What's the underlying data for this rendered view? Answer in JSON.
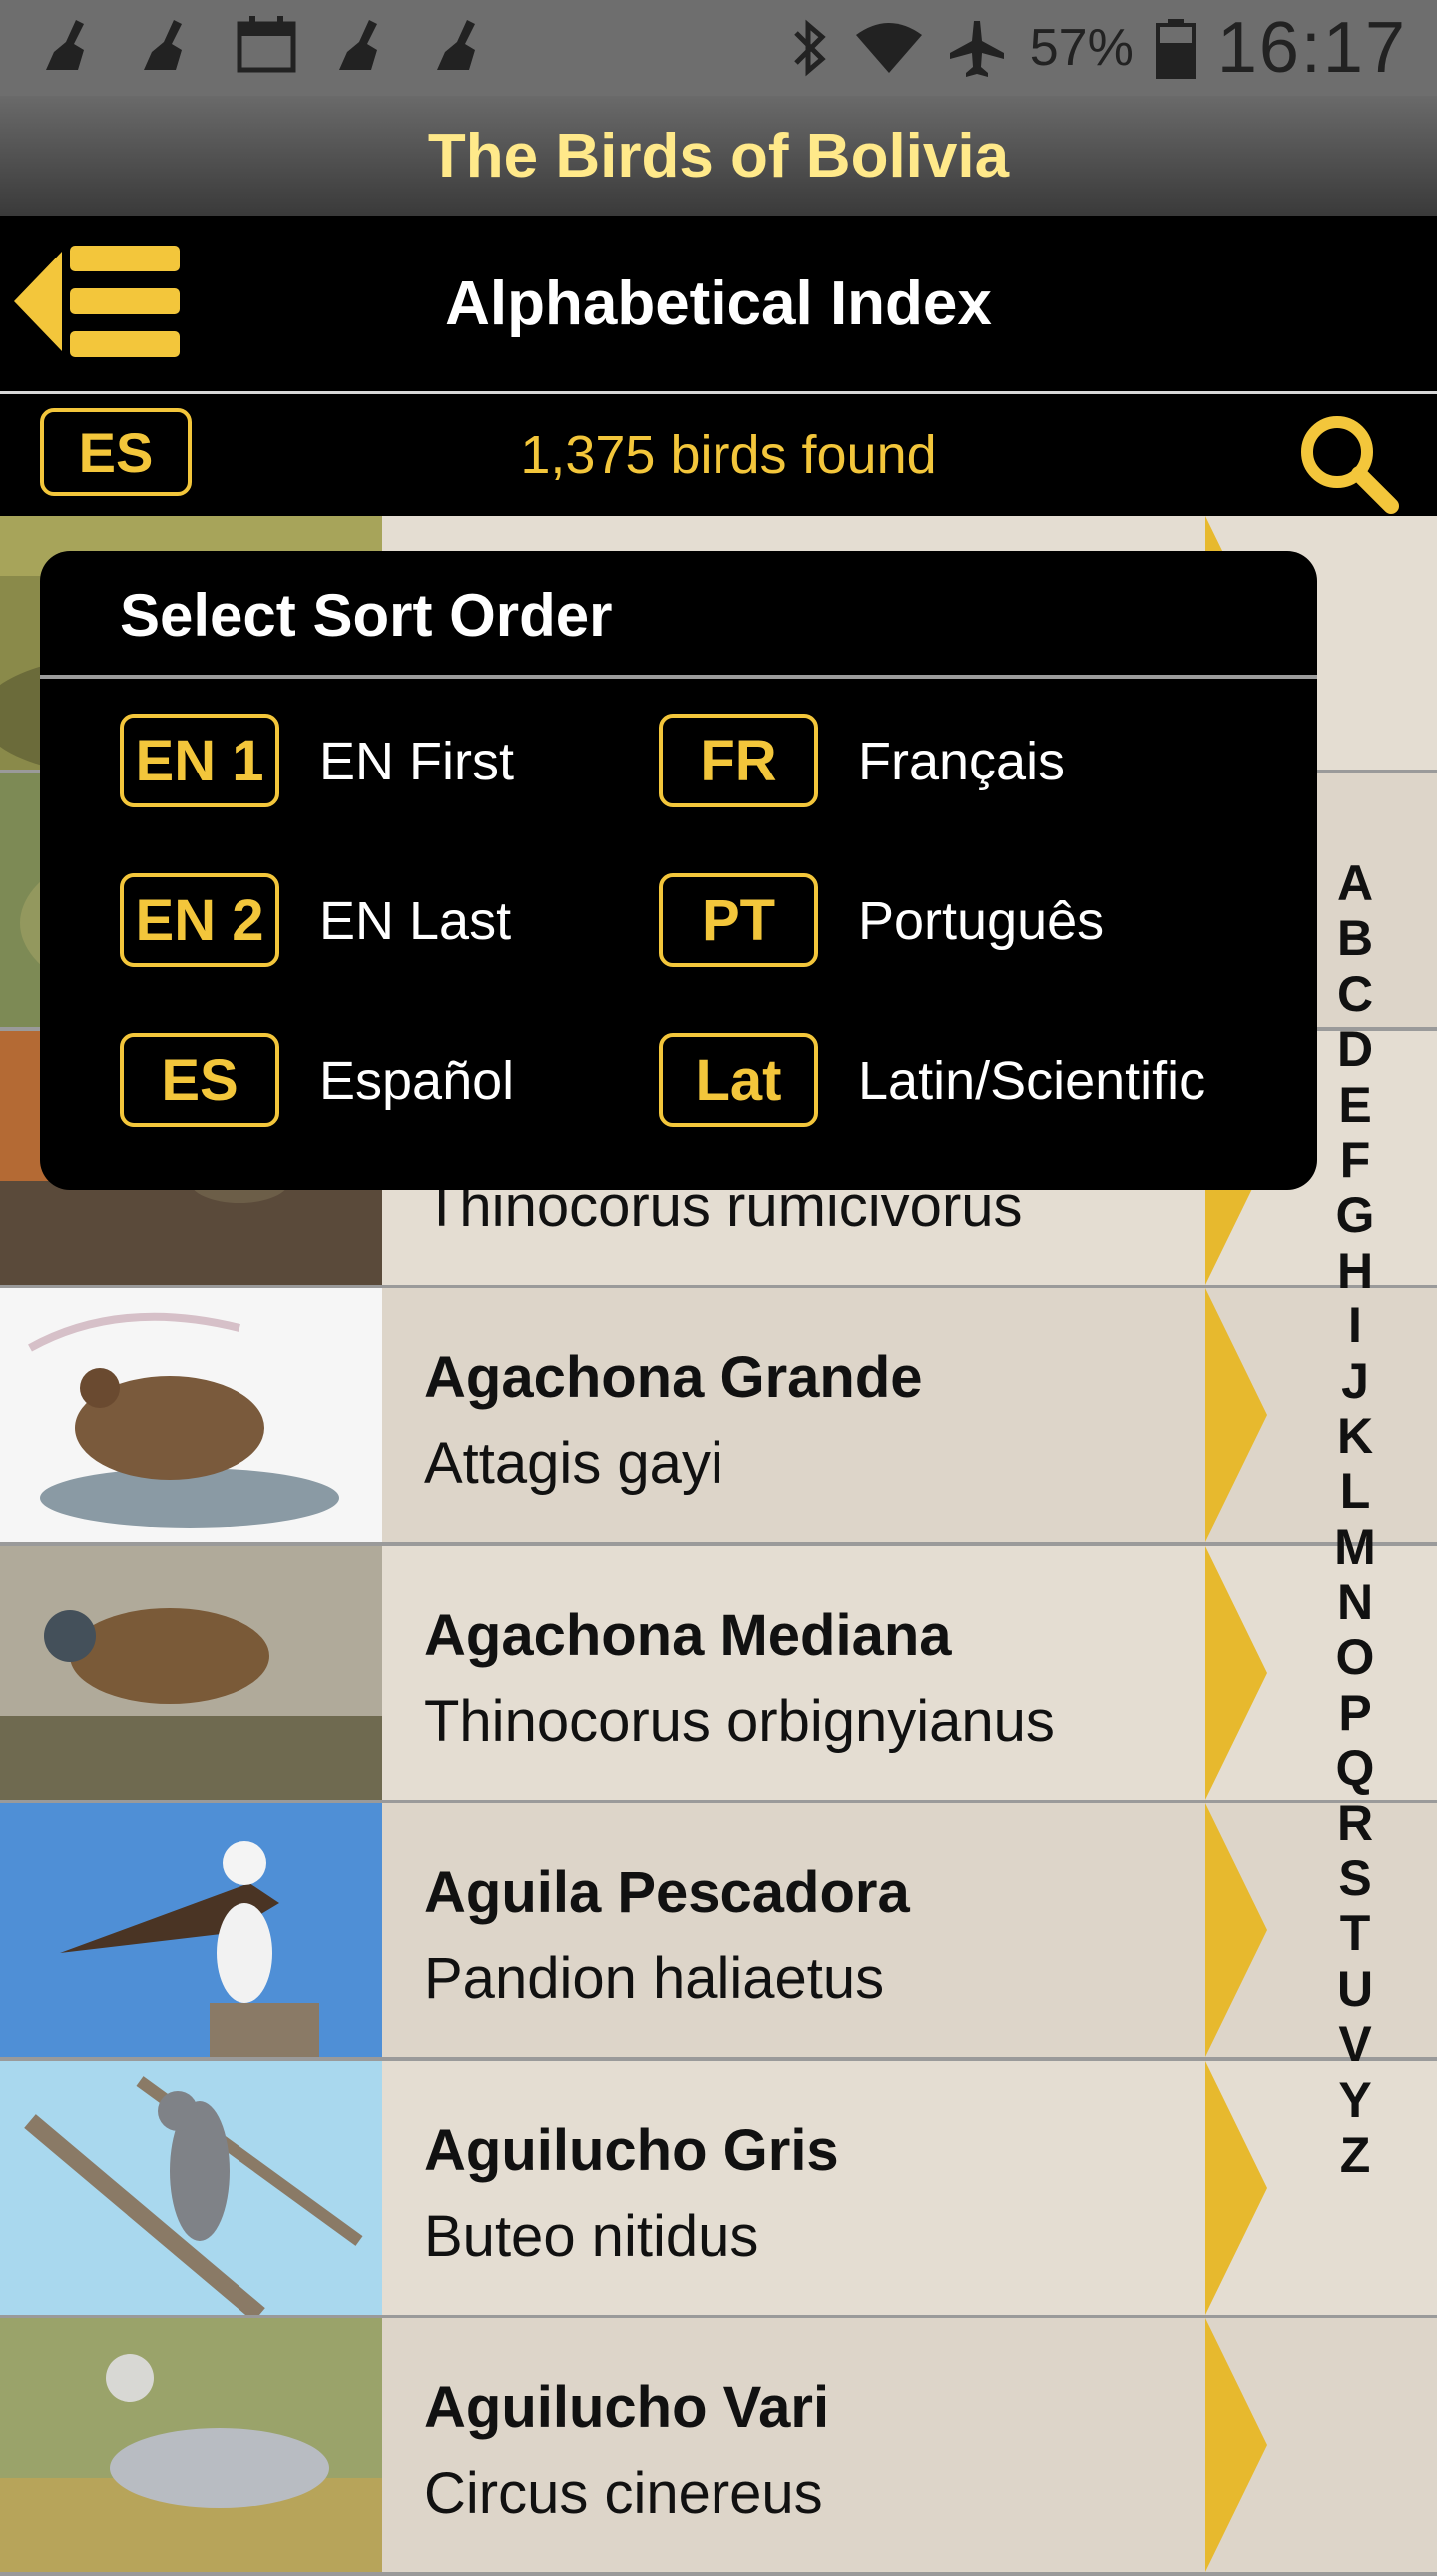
{
  "status_bar": {
    "left_icons": [
      "broom-icon",
      "broom-icon",
      "calendar-icon",
      "broom-icon",
      "broom-icon"
    ],
    "battery_percent": "57%",
    "time": "16:17"
  },
  "app_title": "The Birds of Bolivia",
  "header": {
    "title": "Alphabetical Index"
  },
  "subbar": {
    "lang_code": "ES",
    "found_text": "1,375 birds found"
  },
  "popup": {
    "title": "Select Sort Order",
    "options": [
      {
        "code": "EN 1",
        "label": "EN First"
      },
      {
        "code": "FR",
        "label": "Français"
      },
      {
        "code": "EN 2",
        "label": "EN Last"
      },
      {
        "code": "PT",
        "label": "Português"
      },
      {
        "code": "ES",
        "label": "Español"
      },
      {
        "code": "Lat",
        "label": "Latin/Scientific"
      }
    ]
  },
  "birds": [
    {
      "name": "",
      "latin": ""
    },
    {
      "name": "",
      "latin": ""
    },
    {
      "name": "",
      "latin": "Thinocorus rumicivorus"
    },
    {
      "name": "Agachona Grande",
      "latin": "Attagis gayi"
    },
    {
      "name": "Agachona Mediana",
      "latin": "Thinocorus orbignyianus"
    },
    {
      "name": "Aguila Pescadora",
      "latin": "Pandion haliaetus"
    },
    {
      "name": "Aguilucho Gris",
      "latin": "Buteo nitidus"
    },
    {
      "name": "Aguilucho Vari",
      "latin": "Circus cinereus"
    }
  ],
  "alphabet": [
    "A",
    "B",
    "C",
    "D",
    "E",
    "F",
    "G",
    "H",
    "I",
    "J",
    "K",
    "L",
    "M",
    "N",
    "O",
    "P",
    "Q",
    "R",
    "S",
    "T",
    "U",
    "V",
    "Y",
    "Z"
  ],
  "colors": {
    "accent": "#f3c63b",
    "title_yellow": "#ffe98a",
    "row_bg": "#e4ddd2",
    "arrow": "#e7b92e"
  }
}
